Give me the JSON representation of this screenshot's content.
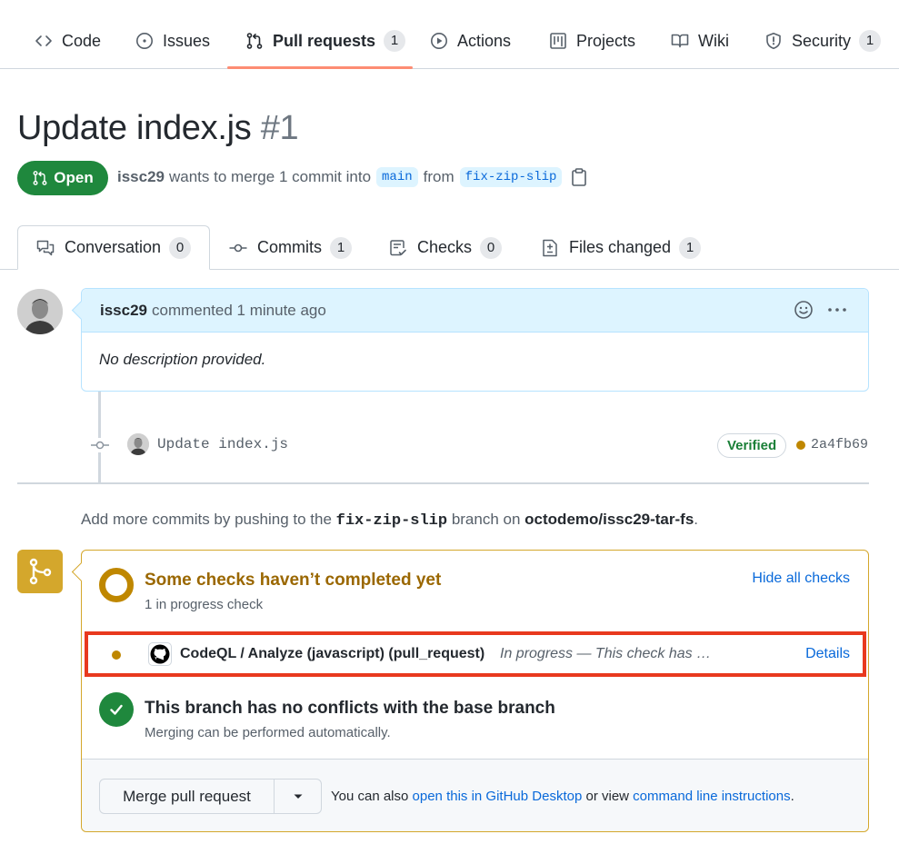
{
  "repo_nav": {
    "items": [
      {
        "label": "Code",
        "icon": "code-icon"
      },
      {
        "label": "Issues",
        "icon": "issue-opened-icon"
      },
      {
        "label": "Pull requests",
        "icon": "git-pull-request-icon",
        "count": "1",
        "active": true
      },
      {
        "label": "Actions",
        "icon": "play-icon"
      },
      {
        "label": "Projects",
        "icon": "project-icon"
      },
      {
        "label": "Wiki",
        "icon": "book-icon"
      },
      {
        "label": "Security",
        "icon": "shield-icon",
        "count": "1"
      }
    ]
  },
  "pr": {
    "title": "Update index.js",
    "number": "#1",
    "state": "Open",
    "author": "issc29",
    "merge_text": "wants to merge 1 commit into",
    "base_branch": "main",
    "from_text": "from",
    "head_branch": "fix-zip-slip"
  },
  "tabs": [
    {
      "label": "Conversation",
      "count": "0",
      "icon": "comment-discussion-icon"
    },
    {
      "label": "Commits",
      "count": "1",
      "icon": "git-commit-icon"
    },
    {
      "label": "Checks",
      "count": "0",
      "icon": "checklist-icon"
    },
    {
      "label": "Files changed",
      "count": "1",
      "icon": "file-diff-icon"
    }
  ],
  "comment": {
    "author": "issc29",
    "action": "commented 1 minute ago",
    "body": "No description provided."
  },
  "commit": {
    "message": "Update index.js",
    "verified": "Verified",
    "sha": "2a4fb69"
  },
  "push_hint": {
    "prefix": "Add more commits by pushing to the",
    "branch": "fix-zip-slip",
    "middle": "branch on",
    "repo": "octodemo/issc29-tar-fs",
    "suffix": "."
  },
  "checks": {
    "title": "Some checks haven’t completed yet",
    "subtitle": "1 in progress check",
    "hide_label": "Hide all checks",
    "items": [
      {
        "name": "CodeQL / Analyze (javascript) (pull_request)",
        "status": "In progress — This check has …",
        "details": "Details"
      }
    ]
  },
  "conflicts": {
    "title": "This branch has no conflicts with the base branch",
    "subtitle": "Merging can be performed automatically."
  },
  "merge": {
    "button": "Merge pull request",
    "hint_prefix": "You can also",
    "desktop_link": "open this in GitHub Desktop",
    "hint_middle": "or view",
    "cli_link": "command line instructions",
    "hint_suffix": "."
  },
  "colors": {
    "accent_underline": "#fd8c73",
    "open_green": "#1f883d",
    "pending_yellow": "#bf8700",
    "link_blue": "#0969da",
    "highlight_red": "#e8391e"
  }
}
